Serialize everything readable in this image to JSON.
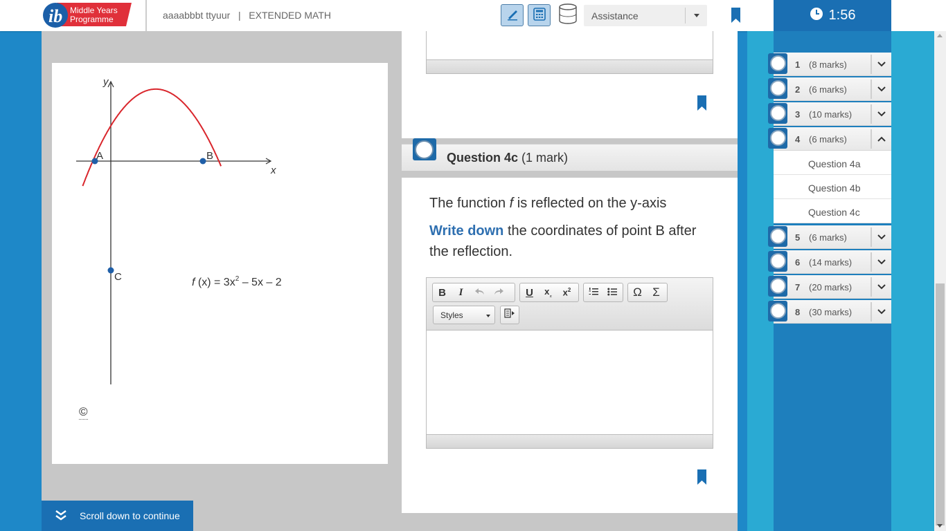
{
  "header": {
    "logo_line1": "Middle Years",
    "logo_line2": "Programme",
    "exam_title": "aaaabbbt ttyuur   |   EXTENDED MATH",
    "assistance_label": "Assistance"
  },
  "timer": {
    "value": "1:56"
  },
  "graph": {
    "y_axis_label": "y",
    "x_axis_label": "x",
    "point_a": "A",
    "point_b": "B",
    "point_c": "C",
    "function_label_f": "f",
    "function_label_rest": " (x) = 3x",
    "function_label_exp": "2",
    "function_label_tail": " – 5x – 2",
    "copyright": "©",
    "curve_color": "#d9262c",
    "point_color": "#1f5fa8"
  },
  "question": {
    "title": "Question 4c",
    "marks": " (1 mark)",
    "text_1_a": "The function ",
    "text_1_f": "f",
    "text_1_b": " is reflected on the y-axis",
    "text_2_kw": "Write down",
    "text_2_rest": " the coordinates of point B after the reflection."
  },
  "editor": {
    "styles_label": "Styles",
    "bold": "B",
    "italic": "I",
    "underline": "U",
    "omega": "Ω",
    "sigma": "Σ"
  },
  "nav": {
    "questions": [
      {
        "num": "1",
        "marks": "(8 marks)"
      },
      {
        "num": "2",
        "marks": "(6 marks)"
      },
      {
        "num": "3",
        "marks": "(10 marks)"
      },
      {
        "num": "4",
        "marks": "(6 marks)"
      },
      {
        "num": "5",
        "marks": "(6 marks)"
      },
      {
        "num": "6",
        "marks": "(14 marks)"
      },
      {
        "num": "7",
        "marks": "(20 marks)"
      },
      {
        "num": "8",
        "marks": "(30 marks)"
      }
    ],
    "sub_items": [
      "Question 4a",
      "Question 4b",
      "Question 4c"
    ]
  },
  "scroll_hint": "Scroll down to continue",
  "colors": {
    "accent": "#1a6fb3",
    "bookmark": "#1a6fb3",
    "sidebar": "#2aaad3"
  }
}
